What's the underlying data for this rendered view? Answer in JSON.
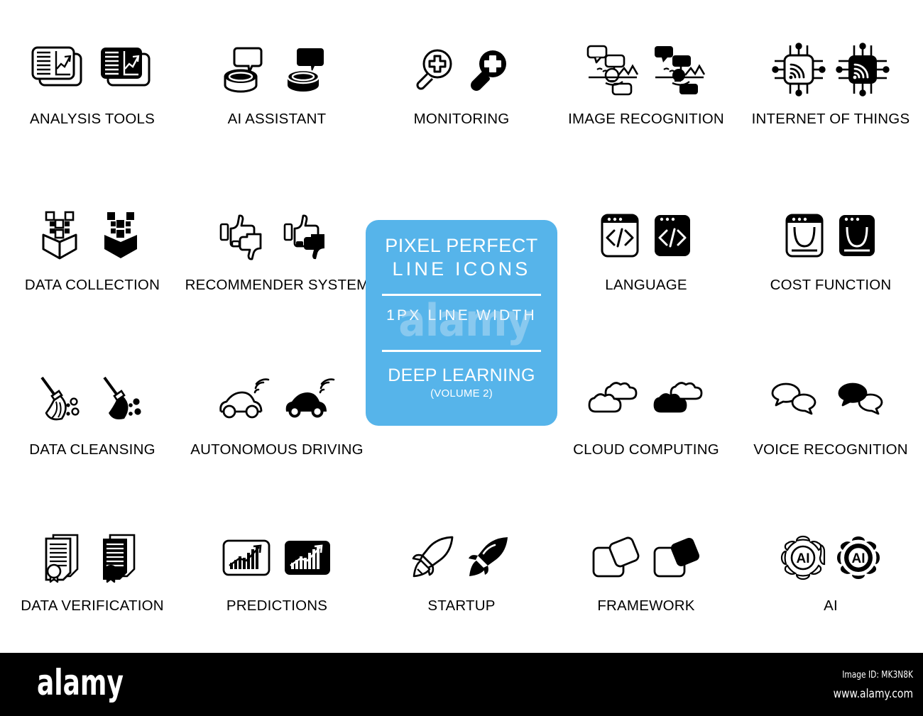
{
  "page": {
    "background_color": "#ffffff",
    "accent_color": "#56b4ea",
    "icon_color": "#000000"
  },
  "promo": {
    "line1": "PIXEL PERFECT",
    "line2": "LINE ICONS",
    "line3": "1PX LINE WIDTH",
    "line4": "DEEP LEARNING",
    "line5": "(VOLUME 2)",
    "watermark": "alamy"
  },
  "icons": [
    {
      "id": "analysis-tools",
      "label": "ANALYSIS TOOLS",
      "row": 1,
      "col": 1
    },
    {
      "id": "ai-assistant",
      "label": "AI ASSISTANT",
      "row": 1,
      "col": 2
    },
    {
      "id": "monitoring",
      "label": "MONITORING",
      "row": 1,
      "col": 3
    },
    {
      "id": "image-recognition",
      "label": "IMAGE RECOGNITION",
      "row": 1,
      "col": 4
    },
    {
      "id": "internet-of-things",
      "label": "INTERNET OF THINGS",
      "row": 1,
      "col": 5
    },
    {
      "id": "data-collection",
      "label": "DATA COLLECTION",
      "row": 2,
      "col": 1
    },
    {
      "id": "recommender-system",
      "label": "RECOMMENDER SYSTEM",
      "row": 2,
      "col": 2
    },
    {
      "id": "language",
      "label": "LANGUAGE",
      "row": 2,
      "col": 4
    },
    {
      "id": "cost-function",
      "label": "COST FUNCTION",
      "row": 2,
      "col": 5
    },
    {
      "id": "data-cleansing",
      "label": "DATA CLEANSING",
      "row": 3,
      "col": 1
    },
    {
      "id": "autonomous-driving",
      "label": "AUTONOMOUS DRIVING",
      "row": 3,
      "col": 2
    },
    {
      "id": "cloud-computing",
      "label": "CLOUD COMPUTING",
      "row": 3,
      "col": 4
    },
    {
      "id": "voice-recognition",
      "label": "VOICE RECOGNITION",
      "row": 3,
      "col": 5
    },
    {
      "id": "data-verification",
      "label": "DATA VERIFICATION",
      "row": 4,
      "col": 1
    },
    {
      "id": "predictions",
      "label": "PREDICTIONS",
      "row": 4,
      "col": 2
    },
    {
      "id": "startup",
      "label": "STARTUP",
      "row": 4,
      "col": 3
    },
    {
      "id": "framework",
      "label": "FRAMEWORK",
      "row": 4,
      "col": 4
    },
    {
      "id": "ai",
      "label": "AI",
      "row": 4,
      "col": 5
    }
  ],
  "footer": {
    "logo": "alamy",
    "image_id": "Image ID: MK3N8K",
    "url": "www.alamy.com"
  }
}
